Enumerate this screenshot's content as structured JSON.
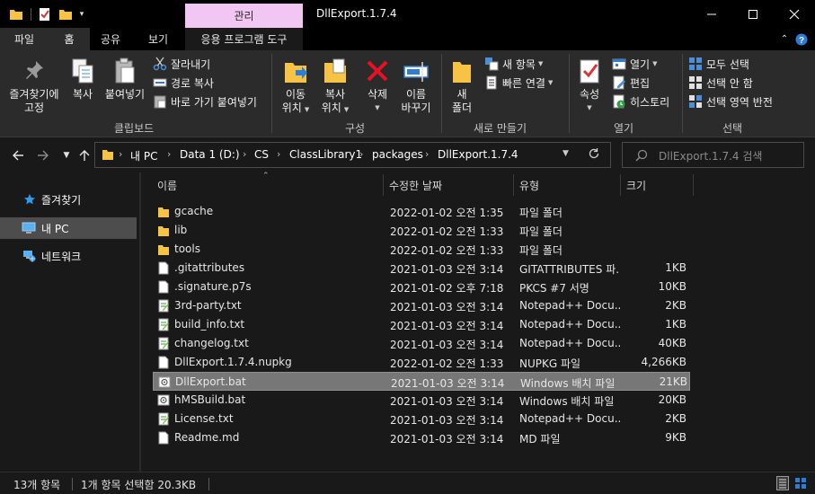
{
  "window": {
    "title": "DllExport.1.7.4",
    "context_tab": "관리",
    "minimize": "—",
    "maximize": "☐",
    "close": "✕"
  },
  "tabs": {
    "file": "파일",
    "home": "홈",
    "share": "공유",
    "view": "보기",
    "app_tools": "응용 프로그램 도구"
  },
  "ribbon": {
    "clipboard": {
      "label": "클립보드",
      "pin_line1": "즐겨찾기에",
      "pin_line2": "고정",
      "copy": "복사",
      "paste": "붙여넣기",
      "cut": "잘라내기",
      "copy_path": "경로 복사",
      "paste_shortcut": "바로 가기 붙여넣기"
    },
    "organize": {
      "label": "구성",
      "move_line1": "이동",
      "move_line2": "위치",
      "copy_line1": "복사",
      "copy_line2": "위치",
      "delete": "삭제",
      "rename_line1": "이름",
      "rename_line2": "바꾸기"
    },
    "new": {
      "label": "새로 만들기",
      "folder_line1": "새",
      "folder_line2": "폴더",
      "new_item": "새 항목",
      "easy_access": "빠른 연결"
    },
    "open": {
      "label": "열기",
      "properties": "속성",
      "open": "열기",
      "edit": "편집",
      "history": "히스토리"
    },
    "select": {
      "label": "선택",
      "select_all": "모두 선택",
      "select_none": "선택 안 함",
      "invert": "선택 영역 반전"
    }
  },
  "address": {
    "crumbs": [
      "내 PC",
      "Data 1 (D:)",
      "CS",
      "ClassLibrary1",
      "packages",
      "DllExport.1.7.4"
    ],
    "search_placeholder": "DllExport.1.7.4 검색"
  },
  "nav": {
    "quick_access": "즐겨찾기",
    "this_pc": "내 PC",
    "network": "네트워크"
  },
  "columns": {
    "name": "이름",
    "modified": "수정한 날짜",
    "type": "유형",
    "size": "크기"
  },
  "files": [
    {
      "name": "gcache",
      "modified": "2022-01-02 오전 1:35",
      "type": "파일 폴더",
      "size": "",
      "icon": "folder"
    },
    {
      "name": "lib",
      "modified": "2022-01-02 오전 1:33",
      "type": "파일 폴더",
      "size": "",
      "icon": "folder"
    },
    {
      "name": "tools",
      "modified": "2022-01-02 오전 1:33",
      "type": "파일 폴더",
      "size": "",
      "icon": "folder"
    },
    {
      "name": ".gitattributes",
      "modified": "2021-01-03 오전 3:14",
      "type": "GITATTRIBUTES 파...",
      "size": "1KB",
      "icon": "blank-file"
    },
    {
      "name": ".signature.p7s",
      "modified": "2021-01-02 오후 7:18",
      "type": "PKCS #7 서명",
      "size": "10KB",
      "icon": "blank-file"
    },
    {
      "name": "3rd-party.txt",
      "modified": "2021-01-03 오전 3:14",
      "type": "Notepad++ Docu...",
      "size": "2KB",
      "icon": "notepad"
    },
    {
      "name": "build_info.txt",
      "modified": "2021-01-03 오전 3:14",
      "type": "Notepad++ Docu...",
      "size": "1KB",
      "icon": "notepad"
    },
    {
      "name": "changelog.txt",
      "modified": "2021-01-03 오전 3:14",
      "type": "Notepad++ Docu...",
      "size": "40KB",
      "icon": "notepad"
    },
    {
      "name": "DllExport.1.7.4.nupkg",
      "modified": "2022-01-02 오전 1:33",
      "type": "NUPKG 파일",
      "size": "4,266KB",
      "icon": "blank-file"
    },
    {
      "name": "DllExport.bat",
      "modified": "2021-01-03 오전 3:14",
      "type": "Windows 배치 파일",
      "size": "21KB",
      "icon": "batch"
    },
    {
      "name": "hMSBuild.bat",
      "modified": "2021-01-03 오전 3:14",
      "type": "Windows 배치 파일",
      "size": "20KB",
      "icon": "batch"
    },
    {
      "name": "License.txt",
      "modified": "2021-01-03 오전 3:14",
      "type": "Notepad++ Docu...",
      "size": "2KB",
      "icon": "notepad"
    },
    {
      "name": "Readme.md",
      "modified": "2021-01-03 오전 3:14",
      "type": "MD 파일",
      "size": "9KB",
      "icon": "blank-file"
    }
  ],
  "selected_index": 9,
  "status": {
    "count": "13개 항목",
    "selection": "1개 항목 선택함 20.3KB"
  },
  "colors": {
    "background": "#191919",
    "ribbon": "#2b2b2b",
    "titlebar": "#000000",
    "context_tab": "#f2c6f2",
    "selected_row": "#777777",
    "folder_yellow": "#f6c344",
    "accent_blue": "#2d7cd6"
  }
}
